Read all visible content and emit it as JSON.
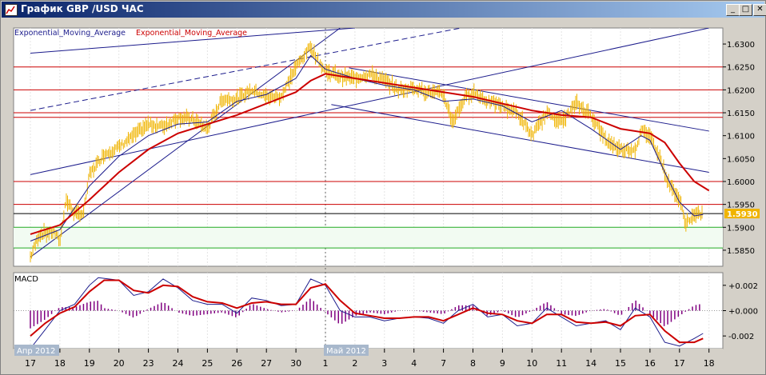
{
  "window": {
    "title": "График GBP /USD ЧАС",
    "buttons": {
      "minimize": "_",
      "maximize": "□",
      "close": "✕"
    },
    "colors": {
      "title_bg": "#0a246a",
      "frame": "#d4d0c8"
    }
  },
  "chart_data": [
    {
      "type": "line",
      "panel": "price",
      "legend": [
        {
          "label": "Exponential_Moving_Average",
          "color": "#1c1c8c"
        },
        {
          "label": "Exponential_Moving_Average",
          "color": "#cc0000"
        }
      ],
      "ylim": [
        1.5815,
        1.6335
      ],
      "yticks": [
        "1.6300",
        "1.6250",
        "1.6200",
        "1.6150",
        "1.6100",
        "1.6050",
        "1.6000",
        "1.5950",
        "1.5900",
        "1.5850"
      ],
      "current_price": "1.5930",
      "x_days": [
        "17",
        "18",
        "19",
        "20",
        "23",
        "24",
        "25",
        "26",
        "27",
        "30",
        "1",
        "2",
        "3",
        "4",
        "7",
        "8",
        "9",
        "10",
        "11",
        "14",
        "15",
        "16",
        "17",
        "18"
      ],
      "month_labels": [
        {
          "label": "Апр 2012",
          "at_day": 0
        },
        {
          "label": "Май 2012",
          "at_day": 10
        }
      ],
      "month_divider_at_day": 10,
      "horizontal_levels": [
        {
          "y": 1.625,
          "color": "#cc0000"
        },
        {
          "y": 1.62,
          "color": "#cc0000"
        },
        {
          "y": 1.615,
          "color": "#cc0000"
        },
        {
          "y": 1.614,
          "color": "#cc0000"
        },
        {
          "y": 1.6,
          "color": "#cc0000"
        },
        {
          "y": 1.595,
          "color": "#cc0000"
        },
        {
          "y": 1.593,
          "color": "#000000"
        },
        {
          "y": 1.59,
          "color": "#22aa22"
        },
        {
          "y": 1.5855,
          "color": "#22aa22"
        }
      ],
      "trendlines": [
        {
          "p1": [
            0,
            1.5835
          ],
          "p2": [
            10.5,
            1.6335
          ],
          "dashed": false
        },
        {
          "p1": [
            0,
            1.6015
          ],
          "p2": [
            23,
            1.6335
          ],
          "dashed": false
        },
        {
          "p1": [
            0,
            1.6155
          ],
          "p2": [
            14.6,
            1.6335
          ],
          "dashed": true
        },
        {
          "p1": [
            0,
            1.628
          ],
          "p2": [
            11,
            1.6335
          ],
          "dashed": false
        },
        {
          "p1": [
            10.8,
            1.6248
          ],
          "p2": [
            23,
            1.611
          ],
          "dashed": false
        },
        {
          "p1": [
            10.2,
            1.6168
          ],
          "p2": [
            23,
            1.602
          ],
          "dashed": false
        }
      ],
      "price_keypoints": [
        [
          0,
          1.5835
        ],
        [
          0.3,
          1.5885
        ],
        [
          0.8,
          1.589
        ],
        [
          1.0,
          1.587
        ],
        [
          1.2,
          1.596
        ],
        [
          1.5,
          1.593
        ],
        [
          1.8,
          1.593
        ],
        [
          2.0,
          1.6015
        ],
        [
          2.5,
          1.606
        ],
        [
          3.0,
          1.6075
        ],
        [
          3.5,
          1.61
        ],
        [
          4.0,
          1.6125
        ],
        [
          4.5,
          1.612
        ],
        [
          5.0,
          1.614
        ],
        [
          5.5,
          1.6135
        ],
        [
          6.0,
          1.6115
        ],
        [
          6.5,
          1.618
        ],
        [
          7.0,
          1.618
        ],
        [
          7.5,
          1.62
        ],
        [
          8.0,
          1.6185
        ],
        [
          8.5,
          1.6185
        ],
        [
          9.0,
          1.625
        ],
        [
          9.5,
          1.6295
        ],
        [
          9.7,
          1.627
        ],
        [
          10.0,
          1.624
        ],
        [
          10.5,
          1.623
        ],
        [
          11.0,
          1.6225
        ],
        [
          11.5,
          1.6235
        ],
        [
          12.0,
          1.622
        ],
        [
          12.5,
          1.62
        ],
        [
          13.0,
          1.6205
        ],
        [
          13.5,
          1.6195
        ],
        [
          14.0,
          1.619
        ],
        [
          14.3,
          1.613
        ],
        [
          14.7,
          1.618
        ],
        [
          15.0,
          1.6195
        ],
        [
          15.5,
          1.6175
        ],
        [
          16.0,
          1.6165
        ],
        [
          16.5,
          1.615
        ],
        [
          17.0,
          1.61
        ],
        [
          17.5,
          1.615
        ],
        [
          18.0,
          1.613
        ],
        [
          18.5,
          1.617
        ],
        [
          19.0,
          1.6145
        ],
        [
          19.5,
          1.609
        ],
        [
          20.0,
          1.607
        ],
        [
          20.5,
          1.607
        ],
        [
          20.7,
          1.611
        ],
        [
          21.0,
          1.61
        ],
        [
          21.3,
          1.606
        ],
        [
          21.6,
          1.6
        ],
        [
          22.0,
          1.596
        ],
        [
          22.2,
          1.591
        ],
        [
          22.5,
          1.5925
        ],
        [
          22.8,
          1.593
        ]
      ],
      "ema_red_keypoints": [
        [
          0,
          1.5885
        ],
        [
          1,
          1.5905
        ],
        [
          2,
          1.596
        ],
        [
          3,
          1.602
        ],
        [
          4,
          1.607
        ],
        [
          5,
          1.6105
        ],
        [
          6,
          1.6125
        ],
        [
          7,
          1.6145
        ],
        [
          8,
          1.617
        ],
        [
          9,
          1.6195
        ],
        [
          9.5,
          1.622
        ],
        [
          10,
          1.6235
        ],
        [
          10.5,
          1.623
        ],
        [
          11,
          1.6225
        ],
        [
          12,
          1.6215
        ],
        [
          13,
          1.6205
        ],
        [
          14,
          1.6195
        ],
        [
          15,
          1.6185
        ],
        [
          16,
          1.617
        ],
        [
          17,
          1.6155
        ],
        [
          18,
          1.6145
        ],
        [
          19,
          1.614
        ],
        [
          20,
          1.6115
        ],
        [
          21,
          1.6105
        ],
        [
          21.5,
          1.6085
        ],
        [
          22,
          1.604
        ],
        [
          22.5,
          1.6
        ],
        [
          23,
          1.598
        ]
      ],
      "ema_blue_keypoints": [
        [
          0,
          1.587
        ],
        [
          1,
          1.5895
        ],
        [
          2,
          1.599
        ],
        [
          3,
          1.6055
        ],
        [
          4,
          1.61
        ],
        [
          5,
          1.6125
        ],
        [
          6,
          1.613
        ],
        [
          7,
          1.6175
        ],
        [
          8,
          1.619
        ],
        [
          9,
          1.6225
        ],
        [
          9.5,
          1.6275
        ],
        [
          10,
          1.6245
        ],
        [
          11,
          1.6225
        ],
        [
          12,
          1.621
        ],
        [
          13,
          1.62
        ],
        [
          14,
          1.6175
        ],
        [
          15,
          1.618
        ],
        [
          16,
          1.6165
        ],
        [
          17,
          1.613
        ],
        [
          18,
          1.6155
        ],
        [
          19,
          1.6115
        ],
        [
          20,
          1.607
        ],
        [
          20.7,
          1.61
        ],
        [
          21,
          1.609
        ],
        [
          21.5,
          1.602
        ],
        [
          22,
          1.5955
        ],
        [
          22.5,
          1.5925
        ],
        [
          22.8,
          1.5928
        ]
      ]
    },
    {
      "type": "line",
      "panel": "macd",
      "title": "MACD",
      "ylim": [
        -0.003,
        0.003
      ],
      "yticks": [
        "+0.002",
        "+0.000",
        "-0.002"
      ],
      "macd_keypoints": [
        [
          0,
          -0.003
        ],
        [
          0.5,
          -0.0015
        ],
        [
          1,
          0.0
        ],
        [
          1.5,
          0.0005
        ],
        [
          2,
          0.002
        ],
        [
          2.3,
          0.0026
        ],
        [
          3,
          0.0024
        ],
        [
          3.5,
          0.0012
        ],
        [
          4,
          0.0015
        ],
        [
          4.5,
          0.0025
        ],
        [
          5,
          0.0018
        ],
        [
          5.5,
          0.0008
        ],
        [
          6,
          0.0005
        ],
        [
          6.5,
          0.0005
        ],
        [
          7,
          -0.0002
        ],
        [
          7.5,
          0.001
        ],
        [
          8,
          0.0008
        ],
        [
          8.5,
          0.0004
        ],
        [
          9,
          0.0005
        ],
        [
          9.5,
          0.0025
        ],
        [
          10,
          0.002
        ],
        [
          10.5,
          0.0
        ],
        [
          11,
          -0.0005
        ],
        [
          11.5,
          -0.0005
        ],
        [
          12,
          -0.0008
        ],
        [
          12.5,
          -0.0006
        ],
        [
          13,
          -0.0005
        ],
        [
          13.5,
          -0.0006
        ],
        [
          14,
          -0.001
        ],
        [
          14.5,
          0.0
        ],
        [
          15,
          0.0005
        ],
        [
          15.5,
          -0.0005
        ],
        [
          16,
          -0.0003
        ],
        [
          16.5,
          -0.0012
        ],
        [
          17,
          -0.001
        ],
        [
          17.5,
          0.0002
        ],
        [
          18,
          -0.0005
        ],
        [
          18.5,
          -0.0012
        ],
        [
          19,
          -0.001
        ],
        [
          19.5,
          -0.0008
        ],
        [
          20,
          -0.0015
        ],
        [
          20.5,
          0.0002
        ],
        [
          21,
          -0.0005
        ],
        [
          21.5,
          -0.0025
        ],
        [
          22,
          -0.0028
        ],
        [
          22.5,
          -0.0022
        ],
        [
          22.8,
          -0.0018
        ]
      ],
      "signal_keypoints": [
        [
          0,
          -0.002
        ],
        [
          0.5,
          -0.001
        ],
        [
          1,
          -0.0002
        ],
        [
          1.5,
          0.0003
        ],
        [
          2,
          0.0015
        ],
        [
          2.5,
          0.0024
        ],
        [
          3,
          0.0024
        ],
        [
          3.5,
          0.0016
        ],
        [
          4,
          0.0014
        ],
        [
          4.5,
          0.002
        ],
        [
          5,
          0.0019
        ],
        [
          5.5,
          0.0011
        ],
        [
          6,
          0.0007
        ],
        [
          6.5,
          0.0006
        ],
        [
          7,
          0.0002
        ],
        [
          7.5,
          0.0006
        ],
        [
          8,
          0.0007
        ],
        [
          8.5,
          0.0005
        ],
        [
          9,
          0.0005
        ],
        [
          9.5,
          0.0018
        ],
        [
          10,
          0.0021
        ],
        [
          10.5,
          0.0008
        ],
        [
          11,
          -0.0002
        ],
        [
          11.5,
          -0.0004
        ],
        [
          12,
          -0.0006
        ],
        [
          12.5,
          -0.0006
        ],
        [
          13,
          -0.0005
        ],
        [
          13.5,
          -0.0005
        ],
        [
          14,
          -0.0008
        ],
        [
          14.5,
          -0.0003
        ],
        [
          15,
          0.0002
        ],
        [
          15.5,
          -0.0002
        ],
        [
          16,
          -0.0003
        ],
        [
          16.5,
          -0.0008
        ],
        [
          17,
          -0.001
        ],
        [
          17.5,
          -0.0003
        ],
        [
          18,
          -0.0003
        ],
        [
          18.5,
          -0.0009
        ],
        [
          19,
          -0.001
        ],
        [
          19.5,
          -0.0009
        ],
        [
          20,
          -0.0012
        ],
        [
          20.5,
          -0.0004
        ],
        [
          21,
          -0.0003
        ],
        [
          21.5,
          -0.0016
        ],
        [
          22,
          -0.0025
        ],
        [
          22.5,
          -0.0025
        ],
        [
          22.8,
          -0.0022
        ]
      ],
      "colors": {
        "macd": "#1c1c8c",
        "signal": "#cc0000",
        "histogram": "#800080"
      }
    }
  ]
}
